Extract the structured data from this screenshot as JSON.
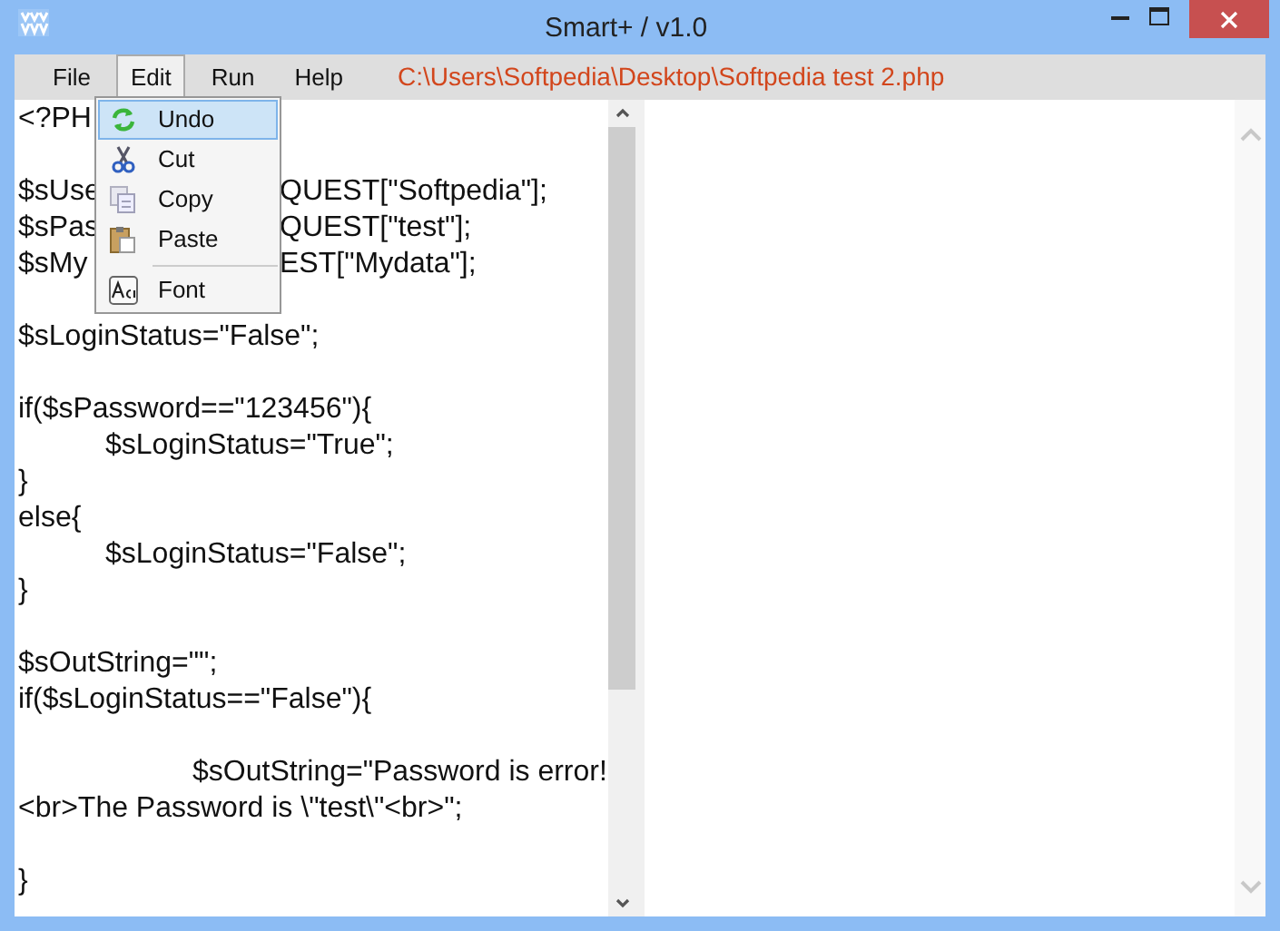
{
  "window": {
    "title": "Smart+ / v1.0"
  },
  "menu_bar": [
    {
      "label": "File",
      "open": false
    },
    {
      "label": "Edit",
      "open": true
    },
    {
      "label": "Run",
      "open": false
    },
    {
      "label": "Help",
      "open": false
    }
  ],
  "file_path": "C:\\Users\\Softpedia\\Desktop\\Softpedia test 2.php",
  "edit_menu": [
    {
      "kind": "item",
      "label": "Undo",
      "selected": true
    },
    {
      "kind": "item",
      "label": "Cut",
      "selected": false
    },
    {
      "kind": "item",
      "label": "Copy",
      "selected": false
    },
    {
      "kind": "item",
      "label": "Paste",
      "selected": false
    },
    {
      "kind": "separator"
    },
    {
      "kind": "item",
      "label": "Font",
      "selected": false
    }
  ],
  "code_lines": [
    {
      "text": "<?PH"
    },
    {
      "kind": "blank"
    },
    {
      "text": "$sUse",
      "after_menu": "QUEST[\"Softpedia\"];"
    },
    {
      "text": "$sPas",
      "after_menu": "QUEST[\"test\"];"
    },
    {
      "text": "$sMy",
      "after_menu": "EST[\"Mydata\"];"
    },
    {
      "kind": "blank"
    },
    {
      "text": "$sLoginStatus=\"False\";"
    },
    {
      "kind": "blank"
    },
    {
      "text": "if($sPassword==\"123456\"){"
    },
    {
      "text": "\t$sLoginStatus=\"True\";"
    },
    {
      "text": "}"
    },
    {
      "text": "else{"
    },
    {
      "text": "\t$sLoginStatus=\"False\";"
    },
    {
      "text": "}"
    },
    {
      "kind": "blank"
    },
    {
      "text": "$sOutString=\"\";"
    },
    {
      "text": "if($sLoginStatus==\"False\"){"
    },
    {
      "kind": "blank"
    },
    {
      "text": "\t\t$sOutString=\"Password is error!"
    },
    {
      "text": "<br>The Password is \\\"test\\\"<br>\";"
    },
    {
      "kind": "blank"
    },
    {
      "text": "}"
    }
  ]
}
